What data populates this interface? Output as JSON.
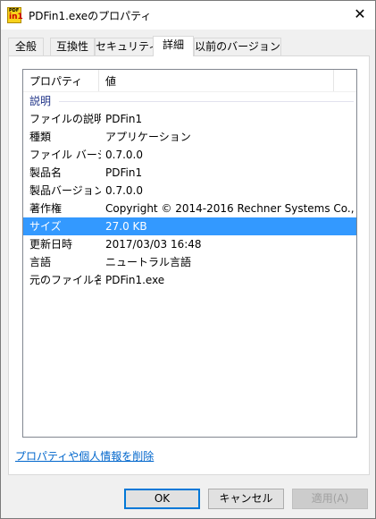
{
  "window": {
    "title": "PDFin1.exeのプロパティ",
    "close_label": "✕",
    "icon": {
      "name": "pdfin1-app-icon",
      "text_top": "PDF",
      "text_bottom": "in1"
    }
  },
  "tabs": [
    {
      "label": "全般",
      "active": false
    },
    {
      "label": "互換性",
      "active": false
    },
    {
      "label": "セキュリティ",
      "active": false
    },
    {
      "label": "詳細",
      "active": true
    },
    {
      "label": "以前のバージョン",
      "active": false
    }
  ],
  "list": {
    "columns": [
      "プロパティ",
      "値"
    ],
    "group": "説明",
    "rows": [
      {
        "name": "ファイルの説明",
        "value": "PDFin1"
      },
      {
        "name": "種類",
        "value": "アプリケーション"
      },
      {
        "name": "ファイル バージョン",
        "value": "0.7.0.0"
      },
      {
        "name": "製品名",
        "value": "PDFin1"
      },
      {
        "name": "製品バージョン",
        "value": "0.7.0.0"
      },
      {
        "name": "著作権",
        "value": "Copyright © 2014-2016 Rechner Systems Co., ..."
      },
      {
        "name": "サイズ",
        "value": "27.0 KB",
        "selected": true
      },
      {
        "name": "更新日時",
        "value": "2017/03/03 16:48"
      },
      {
        "name": "言語",
        "value": "ニュートラル言語"
      },
      {
        "name": "元のファイル名",
        "value": "PDFin1.exe"
      }
    ]
  },
  "remove_link": "プロパティや個人情報を削除",
  "buttons": {
    "ok": "OK",
    "cancel": "キャンセル",
    "apply": "適用(A)"
  },
  "colors": {
    "selection": "#3399ff",
    "link": "#0066cc",
    "group": "#1e3287"
  }
}
